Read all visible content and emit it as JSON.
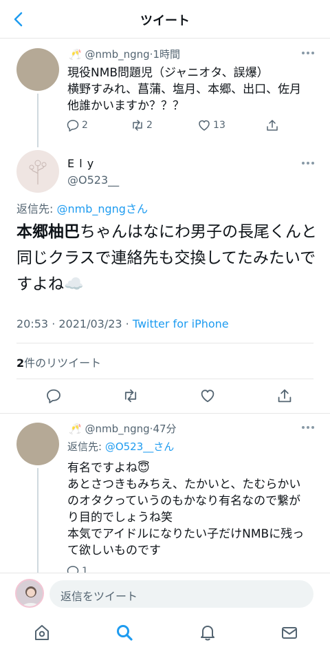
{
  "header": {
    "title": "ツイート"
  },
  "tweet1": {
    "emoji": "🥂",
    "handle": "@nmb_ngng",
    "time": "·1時間",
    "lines": [
      "現役NMB問題児（ジャニオタ、誤爆）",
      "横野すみれ、菖蒲、塩月、本郷、出口、佐月",
      "他誰かいますか？？？"
    ],
    "replies": "2",
    "retweets": "2",
    "likes": "13"
  },
  "main": {
    "name": "E l y",
    "handle": "@O523__",
    "reply_to_label": "返信先: ",
    "reply_to_handle": "@nmb_ngng",
    "reply_to_suffix": "さん",
    "text_bold": "本郷柚巴",
    "text_rest": "ちゃんはなにわ男子の長尾くんと同じクラスで連絡先も交換してたみたいですよね☁️",
    "timestamp": "20:53 · 2021/03/23 · ",
    "client": "Twitter for iPhone",
    "retweet_count": "2",
    "retweet_label": "件のリツイート"
  },
  "tweet3": {
    "emoji": "🥂",
    "handle": "@nmb_ngng",
    "time": "·47分",
    "reply_to_label": "返信先: ",
    "reply_to_handle": "@O523__さん",
    "lines": [
      "有名ですよね😇",
      "あとさつきもみちえ、たかいと、たむらかい",
      "のオタクっていうのもかなり有名なので繋が",
      "り目的でしょうね笑",
      "本気でアイドルになりたい子だけNMBに残っ",
      "て欲しいものです"
    ],
    "replies": "1"
  },
  "reply_bar": {
    "placeholder": "返信をツイート"
  },
  "colors": {
    "accent": "#1d9bf0",
    "muted": "#536471",
    "avatar_tan": "#b5a996"
  },
  "tabs": [
    "home-icon",
    "search-icon",
    "notifications-icon",
    "messages-icon"
  ]
}
